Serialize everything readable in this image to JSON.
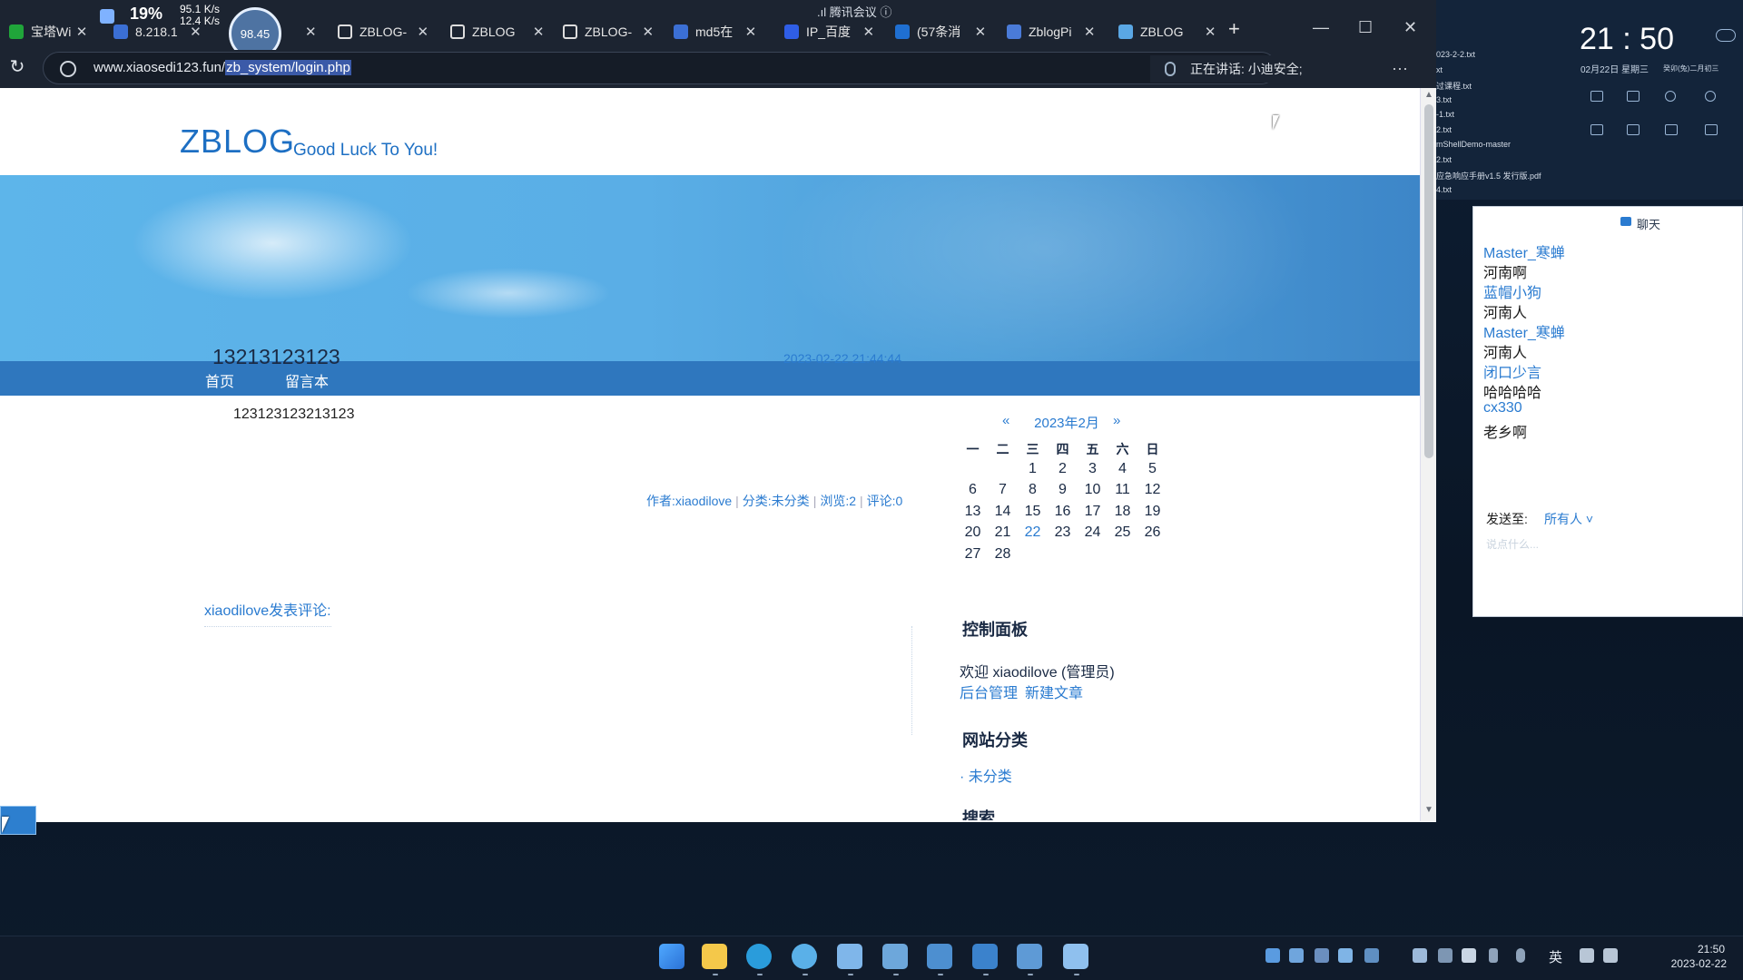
{
  "screen": {
    "cpu_percent": "19%",
    "net_up": "95.1 K/s",
    "net_down": "12.4 K/s",
    "recording_badge": "98.45"
  },
  "browser": {
    "meeting_title": "腾讯会议",
    "tabs": [
      {
        "label": "宝塔Wi",
        "icon_color": "#20a53a"
      },
      {
        "label": "8.218.1",
        "icon_color": "#3b6fd4"
      },
      {
        "label": "98.45",
        "icon_color": "#ffffff"
      },
      {
        "label": "ZBLOG-",
        "icon_color": "#ffffff"
      },
      {
        "label": "ZBLOG",
        "icon_color": "#ffffff"
      },
      {
        "label": "ZBLOG-",
        "icon_color": "#ffffff"
      },
      {
        "label": "md5在",
        "icon_color": "#3b6fd4"
      },
      {
        "label": "IP_百度",
        "icon_color": "#2f5ee6"
      },
      {
        "label": "(57条消",
        "icon_color": "#1f6fd1"
      },
      {
        "label": "ZblogPi",
        "icon_color": "#4a7bd8"
      },
      {
        "label": "ZBLOG",
        "icon_color": "#5aa7e4"
      }
    ],
    "new_tab": "+",
    "url_host": "www.xiaosedi123.fun/",
    "url_path": "zb_system/login.php",
    "voice_status": "正在讲话: 小迪安全;",
    "more": "···"
  },
  "site": {
    "title": "ZBLOG",
    "subtitle": "Good Luck To You!",
    "nav": [
      "首页",
      "留言本"
    ],
    "post": {
      "title": "13213123123",
      "date": "2023-02-22 21:44:44",
      "body": "123123123213123",
      "author": "作者:xiaodilove",
      "category": "分类:未分类",
      "views": "浏览:2",
      "comments": "评论:0"
    },
    "comment_heading": "xiaodilove发表评论:",
    "calendar": {
      "prev": "«",
      "next": "»",
      "month": "2023年2月",
      "weekdays": [
        "一",
        "二",
        "三",
        "四",
        "五",
        "六",
        "日"
      ],
      "weeks": [
        [
          "",
          "",
          "1",
          "2",
          "3",
          "4",
          "5"
        ],
        [
          "6",
          "7",
          "8",
          "9",
          "10",
          "11",
          "12"
        ],
        [
          "13",
          "14",
          "15",
          "16",
          "17",
          "18",
          "19"
        ],
        [
          "20",
          "21",
          "22",
          "23",
          "24",
          "25",
          "26"
        ],
        [
          "27",
          "28",
          "",
          "",
          "",
          "",
          ""
        ]
      ],
      "today": "22"
    },
    "control_panel_title": "控制面板",
    "welcome": "欢迎 xiaodilove (管理员)",
    "admin_link": "后台管理",
    "new_post_link": "新建文章",
    "categories_title": "网站分类",
    "category_item": "· 未分类",
    "search_title": "搜索"
  },
  "desktop": {
    "clock": "21 : 50",
    "clock_date": "02月22日  星期三",
    "lunar": "癸卯(兔)二月初三",
    "files": [
      "023-2-2.txt",
      "xt",
      "过课程.txt",
      "3.txt",
      "-1.txt",
      "2.txt",
      "mShellDemo-master",
      "2.txt",
      "应急响应手册v1.5 发行版.pdf",
      "4.txt"
    ]
  },
  "chat": {
    "title": "聊天",
    "messages": [
      {
        "name": "Master_寒蝉",
        "text": "河南啊"
      },
      {
        "name": "蓝帽小狗",
        "text": "河南人"
      },
      {
        "name": "Master_寒蝉",
        "text": "河南人"
      },
      {
        "name": "闭口少言",
        "text": "哈哈哈哈"
      },
      {
        "name": "cx330",
        "text": "老乡啊"
      }
    ],
    "send_to_label": "发送至:",
    "send_to_value": "所有人 ˅",
    "input_placeholder": "说点什么..."
  },
  "taskbar": {
    "lang": "英",
    "time": "21:50",
    "date": "2023-02-22"
  },
  "colors": {
    "brand_blue": "#1d6fc3",
    "link_blue": "#2a7bd0",
    "nav_blue": "#2f77be"
  }
}
